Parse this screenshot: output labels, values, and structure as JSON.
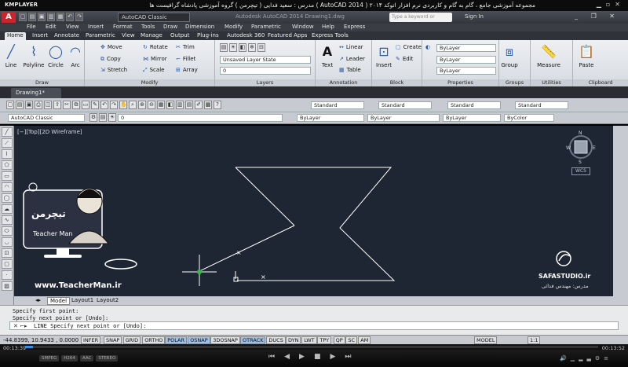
{
  "player": {
    "logo": "KMPLAYER",
    "video_title": "مجموعه آموزشی جامع ، گام به گام و کاربردی نرم افزار   اتوکد ۲۰۱۴ ( AutoCAD 2014 )   مدرس : سعید فدایی ( تیچرمن ) گروه آموزشی پادشاه گرافیست ها",
    "time_elapsed": "00:13:39",
    "time_total": "00:13:52",
    "badges": [
      "SMPEG",
      "H264",
      "AAC",
      "STEREO"
    ]
  },
  "acad": {
    "workspace": "AutoCAD Classic",
    "window_title": "Autodesk AutoCAD 2014   Drawing1.dwg",
    "search_placeholder": "Type a keyword or phrase",
    "sign_in": "Sign In",
    "menu": [
      "File",
      "Edit",
      "View",
      "Insert",
      "Format",
      "Tools",
      "Draw",
      "Dimension",
      "Modify",
      "Parametric",
      "Window",
      "Help",
      "Express"
    ],
    "ribbon_tabs": [
      "Home",
      "Insert",
      "Annotate",
      "Parametric",
      "View",
      "Manage",
      "Output",
      "Plug-ins",
      "Autodesk 360",
      "Featured Apps",
      "Express Tools"
    ],
    "active_tab": "Home",
    "draw": {
      "title": "Draw",
      "line": "Line",
      "polyline": "Polyline",
      "circle": "Circle",
      "arc": "Arc"
    },
    "modify": {
      "title": "Modify",
      "move": "Move",
      "rotate": "Rotate",
      "trim": "Trim",
      "copy": "Copy",
      "mirror": "Mirror",
      "fillet": "Fillet",
      "stretch": "Stretch",
      "scale": "Scale",
      "array": "Array"
    },
    "layers": {
      "title": "Layers",
      "state": "Unsaved Layer State",
      "layer_value": "0"
    },
    "annotation": {
      "title": "Annotation",
      "text": "Text",
      "linear": "Linear",
      "leader": "Leader",
      "table": "Table"
    },
    "block": {
      "title": "Block",
      "insert": "Insert",
      "create": "Create",
      "edit": "Edit"
    },
    "properties": {
      "title": "Properties",
      "bylayer1": "ByLayer",
      "bylayer2": "ByLayer",
      "bylayer3": "ByLayer"
    },
    "groups": {
      "title": "Groups",
      "group": "Group"
    },
    "utilities": {
      "title": "Utilities",
      "measure": "Measure"
    },
    "clipboard": {
      "title": "Clipboard",
      "paste": "Paste"
    },
    "file_tab": "Drawing1*",
    "toolbar_combos": [
      "Standard",
      "Standard",
      "Standard",
      "Standard"
    ],
    "toolbar2": {
      "workspace": "AutoCAD Classic",
      "layer": "0",
      "color": "ByLayer",
      "linetype": "ByLayer",
      "lineweight": "ByLayer",
      "plotstyle": "ByColor"
    },
    "view_label": "[−][Top][2D Wireframe]",
    "wcs": "WCS",
    "layout_tabs": [
      "Model",
      "Layout1",
      "Layout2"
    ],
    "command_history": [
      "Specify first point:",
      "Specify next point or [Undo]:"
    ],
    "command_prompt": "LINE Specify next point or [Undo]:",
    "coords": "-44.8399, 10.9433 , 0.0000",
    "status_buttons": [
      {
        "label": "INFER",
        "on": false
      },
      {
        "label": "SNAP",
        "on": false
      },
      {
        "label": "GRID",
        "on": false
      },
      {
        "label": "ORTHO",
        "on": false
      },
      {
        "label": "POLAR",
        "on": true
      },
      {
        "label": "OSNAP",
        "on": true
      },
      {
        "label": "3DOSNAP",
        "on": false
      },
      {
        "label": "OTRACK",
        "on": true
      },
      {
        "label": "DUCS",
        "on": false
      },
      {
        "label": "DYN",
        "on": false
      },
      {
        "label": "LWT",
        "on": false
      },
      {
        "label": "TPY",
        "on": false
      },
      {
        "label": "QP",
        "on": false
      },
      {
        "label": "SC",
        "on": false
      },
      {
        "label": "AM",
        "on": false
      }
    ],
    "model_label": "MODEL",
    "scale": "1:1"
  },
  "overlay": {
    "teacher_url": "www.TeacherMan.ir",
    "teacher_brand": "Teacher Man",
    "teacher_brand_fa": "تیچرمن",
    "studio": "SAFASTUDIO.ir",
    "studio_sub": "مدرس: مهندس فدائی"
  },
  "colors": {
    "canvas": "#1f2633",
    "ribbon": "#dfe2e7",
    "status_on": "#9fbfe6",
    "acad_red": "#c8262c"
  }
}
